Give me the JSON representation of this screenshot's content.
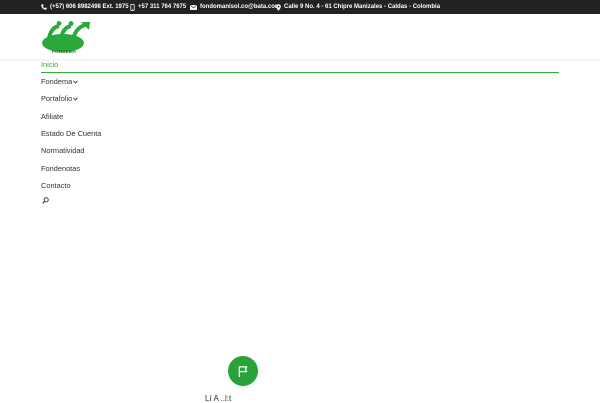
{
  "topbar": {
    "phone": "(+57) 606 8982498 Ext. 1975",
    "mobile": "+57 311 764 7675",
    "email": "fondomanisol.co@bata.com",
    "address": "Calle 9 No. 4 - 61 Chipre Manizales - Caldas - Colombia"
  },
  "logo": {
    "text": "FONDEMA"
  },
  "nav": {
    "items": [
      {
        "label": "Inicio",
        "active": true
      },
      {
        "label": "Fondema",
        "has_submenu": true
      },
      {
        "label": "Portafolio",
        "has_submenu": true
      },
      {
        "label": "Afiliate"
      },
      {
        "label": "Estado De Cuenta"
      },
      {
        "label": "Normatividad"
      },
      {
        "label": "Fondenotas"
      },
      {
        "label": "Contacto"
      }
    ]
  },
  "content": {
    "partial_heading": "Lí      A      ..l:t"
  },
  "colors": {
    "accent": "#2cae3a",
    "topbar_bg": "#222222",
    "text": "#333333"
  },
  "icons": [
    "phone-icon",
    "mobile-icon",
    "email-icon",
    "location-icon",
    "search-icon",
    "flag-icon",
    "chevron-down-icon"
  ]
}
